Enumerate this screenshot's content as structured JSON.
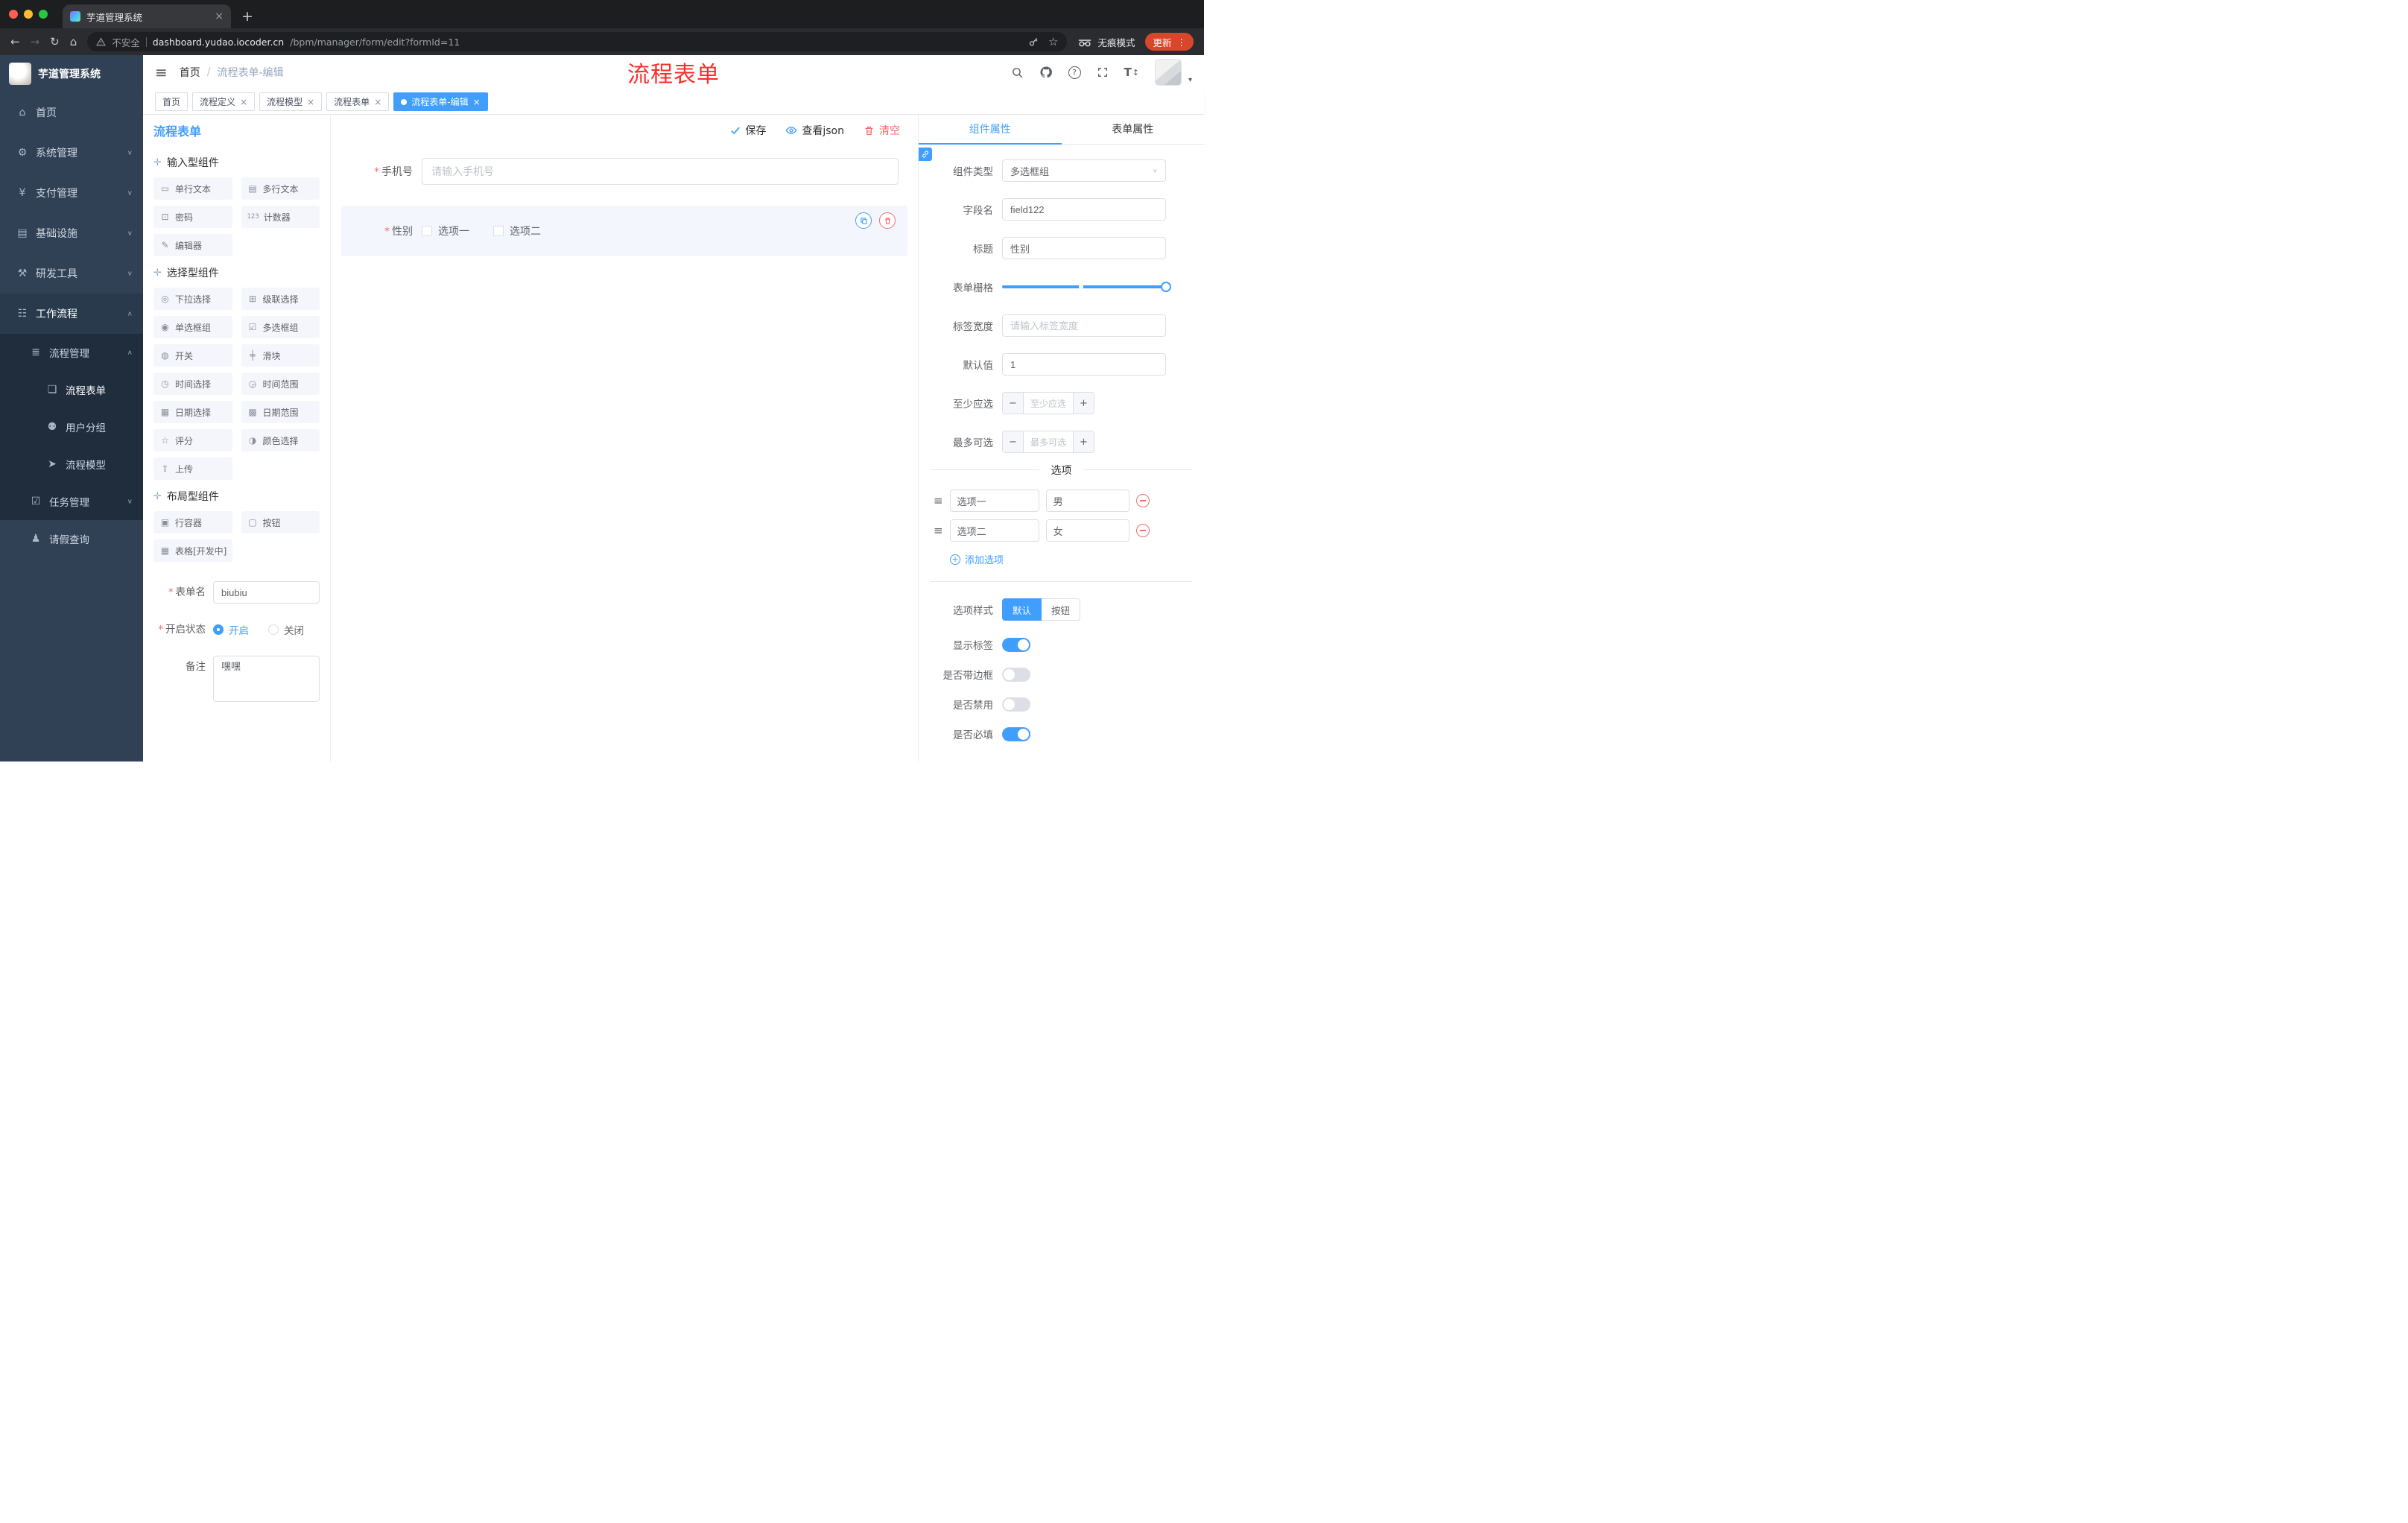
{
  "colors": {
    "primary": "#409eff",
    "danger": "#f56c6c",
    "annotation": "#ff2b2b",
    "sidebar_bg": "#304156",
    "submenu_bg": "#1f2d3d",
    "update_pill": "#d9472b"
  },
  "glyphs": {
    "close": "×",
    "plus_tab": "+",
    "back": "←",
    "forward": "→",
    "reload": "↻",
    "home": "⌂",
    "star": "☆",
    "dots_vertical": "⋮",
    "hamburger": "≡",
    "breadcrumb_sep": "/",
    "question": "?",
    "font_t": "T",
    "font_arrows": "↕",
    "avatar_caret": "▾",
    "drag": "✛",
    "select_chev": "∨",
    "minus": "−",
    "plus": "+",
    "required": "*",
    "option_drag": "≡"
  },
  "browser": {
    "tab_title": "芋道管理系统",
    "security": "不安全",
    "domain": "dashboard.yudao.iocoder.cn",
    "path": "/bpm/manager/form/edit?formId=11",
    "incognito": "无痕模式",
    "update": "更新"
  },
  "sidebar": {
    "title": "芋道管理系统",
    "items": [
      {
        "label": "首页",
        "icon": "⌂"
      },
      {
        "label": "系统管理",
        "icon": "⚙",
        "chev": "∨"
      },
      {
        "label": "支付管理",
        "icon": "¥",
        "chev": "∨"
      },
      {
        "label": "基础设施",
        "icon": "▤",
        "chev": "∨"
      },
      {
        "label": "研发工具",
        "icon": "⚒",
        "chev": "∨"
      },
      {
        "label": "工作流程",
        "icon": "☷",
        "chev": "∧"
      },
      {
        "label": "流程管理",
        "icon": "≣",
        "chev": "∧"
      },
      {
        "label": "流程表单",
        "icon": "❏"
      },
      {
        "label": "用户分组",
        "icon": "⚉"
      },
      {
        "label": "流程模型",
        "icon": "➤"
      },
      {
        "label": "任务管理",
        "icon": "☑",
        "chev": "∨"
      },
      {
        "label": "请假查询",
        "icon": "♟"
      }
    ]
  },
  "header": {
    "breadcrumb_home": "首页",
    "breadcrumb_current": "流程表单-编辑",
    "annotation": "流程表单"
  },
  "tags": [
    {
      "label": "首页"
    },
    {
      "label": "流程定义"
    },
    {
      "label": "流程模型"
    },
    {
      "label": "流程表单"
    },
    {
      "label": "流程表单-编辑"
    }
  ],
  "designer": {
    "title": "流程表单",
    "toolbar": {
      "save": "保存",
      "view_json": "查看json",
      "clear": "清空"
    },
    "groups": [
      {
        "title": "输入型组件",
        "items": [
          {
            "label": "单行文本",
            "icon": "▭"
          },
          {
            "label": "多行文本",
            "icon": "▤"
          },
          {
            "label": "密码",
            "icon": "⊡"
          },
          {
            "label": "计数器",
            "icon": "123"
          },
          {
            "label": "编辑器",
            "icon": "✎"
          }
        ]
      },
      {
        "title": "选择型组件",
        "items": [
          {
            "label": "下拉选择",
            "icon": "◎"
          },
          {
            "label": "级联选择",
            "icon": "⊞"
          },
          {
            "label": "单选框组",
            "icon": "◉"
          },
          {
            "label": "多选框组",
            "icon": "☑"
          },
          {
            "label": "开关",
            "icon": "◍"
          },
          {
            "label": "滑块",
            "icon": "╪"
          },
          {
            "label": "时间选择",
            "icon": "◷"
          },
          {
            "label": "时间范围",
            "icon": "◶"
          },
          {
            "label": "日期选择",
            "icon": "▦"
          },
          {
            "label": "日期范围",
            "icon": "▩"
          },
          {
            "label": "评分",
            "icon": "☆"
          },
          {
            "label": "颜色选择",
            "icon": "◑"
          },
          {
            "label": "上传",
            "icon": "⇧"
          }
        ]
      },
      {
        "title": "布局型组件",
        "items": [
          {
            "label": "行容器",
            "icon": "▣"
          },
          {
            "label": "按钮",
            "icon": "▢"
          },
          {
            "label": "表格[开发中]",
            "icon": "▦"
          }
        ]
      }
    ],
    "meta": {
      "form_name_label": "表单名",
      "form_name_value": "biubiu",
      "status_label": "开启状态",
      "status_on": "开启",
      "status_off": "关闭",
      "remark_label": "备注",
      "remark_value": "嘿嘿"
    },
    "canvas": {
      "phone_label": "手机号",
      "phone_placeholder": "请输入手机号",
      "gender_label": "性别",
      "gender_options": [
        "选项一",
        "选项二"
      ]
    }
  },
  "props": {
    "tab_component": "组件属性",
    "tab_form": "表单属性",
    "type_label": "组件类型",
    "type_value": "多选框组",
    "field_label": "字段名",
    "field_value": "field122",
    "title_label": "标题",
    "title_value": "性别",
    "grid_label": "表单栅格",
    "width_label": "标签宽度",
    "width_placeholder": "请输入标签宽度",
    "default_label": "默认值",
    "default_value": "1",
    "min_label": "至少应选",
    "min_placeholder": "至少应选",
    "max_label": "最多可选",
    "max_placeholder": "最多可选",
    "options_title": "选项",
    "options": [
      {
        "name": "选项一",
        "value": "男"
      },
      {
        "name": "选项二",
        "value": "女"
      }
    ],
    "add_option": "添加选项",
    "style_label": "选项样式",
    "style_default": "默认",
    "style_button": "按钮",
    "switches": [
      {
        "label": "显示标签",
        "on": true
      },
      {
        "label": "是否带边框",
        "on": false
      },
      {
        "label": "是否禁用",
        "on": false
      },
      {
        "label": "是否必填",
        "on": true
      }
    ]
  }
}
